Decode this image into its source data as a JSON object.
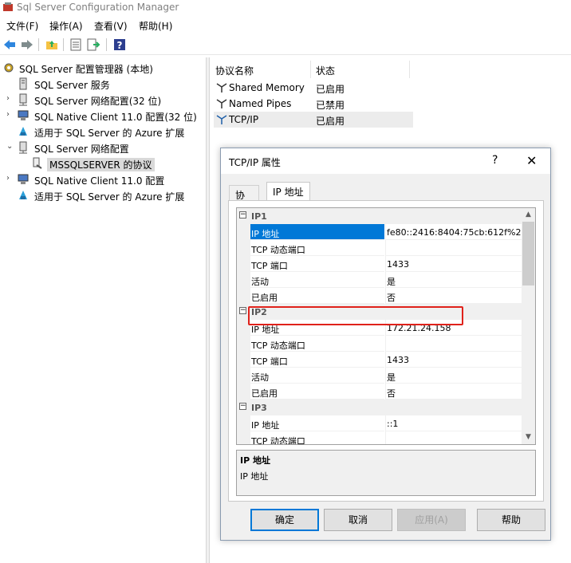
{
  "window": {
    "title": "Sql Server Configuration Manager"
  },
  "menu": [
    "文件(F)",
    "操作(A)",
    "查看(V)",
    "帮助(H)"
  ],
  "toolbar": {
    "icons": [
      "back-arrow",
      "forward-arrow",
      "folder-up",
      "properties",
      "export-list",
      "help"
    ]
  },
  "tree": [
    {
      "label": "SQL Server 配置管理器 (本地)",
      "icon": "config-manager-icon"
    },
    {
      "label": "SQL Server 服务",
      "icon": "service-icon"
    },
    {
      "label": "SQL Server 网络配置(32 位)",
      "icon": "network-icon",
      "expander": "›"
    },
    {
      "label": "SQL Native Client 11.0 配置(32 位)",
      "icon": "client-icon",
      "expander": "›"
    },
    {
      "label": "适用于 SQL Server 的 Azure 扩展",
      "icon": "azure-icon"
    },
    {
      "label": "SQL Server 网络配置",
      "icon": "network-icon",
      "expander": "⌄"
    },
    {
      "label": "MSSQLSERVER 的协议",
      "icon": "protocol-icon"
    },
    {
      "label": "SQL Native Client 11.0 配置",
      "icon": "client-icon",
      "expander": "›"
    },
    {
      "label": "适用于 SQL Server 的 Azure 扩展",
      "icon": "azure-icon"
    }
  ],
  "list": {
    "columns": [
      "协议名称",
      "状态"
    ],
    "rows": [
      {
        "name": "Shared Memory",
        "status": "已启用"
      },
      {
        "name": "Named Pipes",
        "status": "已禁用"
      },
      {
        "name": "TCP/IP",
        "status": "已启用"
      }
    ]
  },
  "dialog": {
    "title": "TCP/IP 属性",
    "help": "?",
    "close": "✕",
    "tabs": [
      "协议",
      "IP 地址"
    ],
    "grid": [
      {
        "cat": "IP1"
      },
      {
        "k": "IP 地址",
        "v": "fe80::2416:8404:75cb:612f%2"
      },
      {
        "k": "TCP 动态端口",
        "v": ""
      },
      {
        "k": "TCP 端口",
        "v": "1433"
      },
      {
        "k": "活动",
        "v": "是"
      },
      {
        "k": "已启用",
        "v": "否"
      },
      {
        "cat": "IP2"
      },
      {
        "k": "IP 地址",
        "v": "172.21.24.158"
      },
      {
        "k": "TCP 动态端口",
        "v": ""
      },
      {
        "k": "TCP 端口",
        "v": "1433"
      },
      {
        "k": "活动",
        "v": "是"
      },
      {
        "k": "已启用",
        "v": "否"
      },
      {
        "cat": "IP3"
      },
      {
        "k": "IP 地址",
        "v": "::1"
      },
      {
        "k": "TCP 动态端口",
        "v": ""
      }
    ],
    "desc_title": "IP 地址",
    "desc_text": "IP 地址",
    "buttons": {
      "ok": "确定",
      "cancel": "取消",
      "apply": "应用(A)",
      "help": "帮助"
    }
  },
  "colors": {
    "selection": "#0078d7",
    "highlight_box": "#e0221b"
  }
}
